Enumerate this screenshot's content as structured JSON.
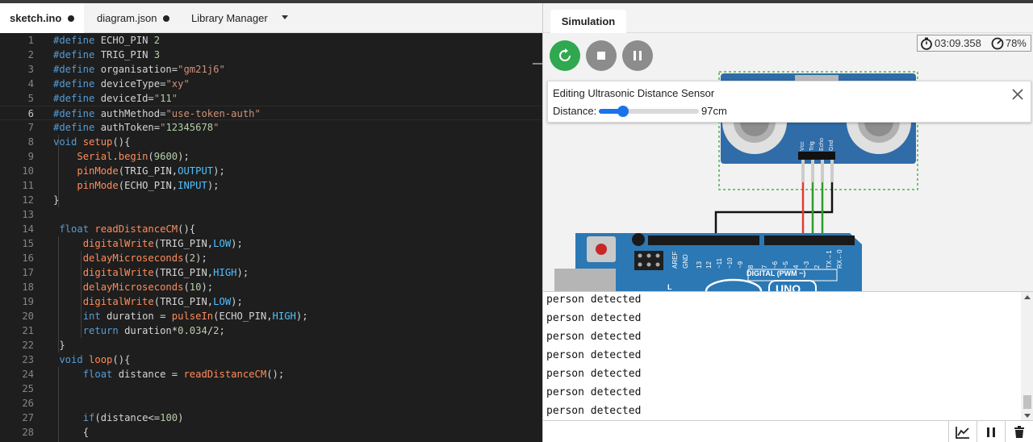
{
  "editor": {
    "tabs": [
      {
        "label": "sketch.ino",
        "modified": true
      },
      {
        "label": "diagram.json",
        "modified": true
      },
      {
        "label": "Library Manager",
        "dropdown": true
      }
    ],
    "lines": [
      {
        "num": "1",
        "text": "#define ECHO_PIN 2"
      },
      {
        "num": "2",
        "text": "#define TRIG_PIN 3"
      },
      {
        "num": "3",
        "text": "#define organisation=\"gm21j6\""
      },
      {
        "num": "4",
        "text": "#define deviceType=\"xy\""
      },
      {
        "num": "5",
        "text": "#define deviceId=\"11\""
      },
      {
        "num": "6",
        "text": "#define authMethod=\"use-token-auth\""
      },
      {
        "num": "7",
        "text": "#define authToken=\"12345678\""
      },
      {
        "num": "8",
        "text": "void setup(){"
      },
      {
        "num": "9",
        "text": "    Serial.begin(9600);"
      },
      {
        "num": "10",
        "text": "    pinMode(TRIG_PIN,OUTPUT);"
      },
      {
        "num": "11",
        "text": "    pinMode(ECHO_PIN,INPUT);"
      },
      {
        "num": "12",
        "text": "}"
      },
      {
        "num": "13",
        "text": ""
      },
      {
        "num": "14",
        "text": " float readDistanceCM(){"
      },
      {
        "num": "15",
        "text": "     digitalWrite(TRIG_PIN,LOW);"
      },
      {
        "num": "16",
        "text": "     delayMicroseconds(2);"
      },
      {
        "num": "17",
        "text": "     digitalWrite(TRIG_PIN,HIGH);"
      },
      {
        "num": "18",
        "text": "     delayMicroseconds(10);"
      },
      {
        "num": "19",
        "text": "     digitalWrite(TRIG_PIN,LOW);"
      },
      {
        "num": "20",
        "text": "     int duration = pulseIn(ECHO_PIN,HIGH);"
      },
      {
        "num": "21",
        "text": "     return duration*0.034/2;"
      },
      {
        "num": "22",
        "text": " }"
      },
      {
        "num": "23",
        "text": " void loop(){"
      },
      {
        "num": "24",
        "text": "     float distance = readDistanceCM();"
      },
      {
        "num": "25",
        "text": ""
      },
      {
        "num": "26",
        "text": ""
      },
      {
        "num": "27",
        "text": "     if(distance<=100)"
      },
      {
        "num": "28",
        "text": "     {"
      }
    ],
    "current_line": 6
  },
  "simulation": {
    "tab_label": "Simulation",
    "timer": "03:09.358",
    "speed": "78%",
    "controls": {
      "restart": "restart-icon",
      "stop": "stop-icon",
      "pause": "pause-icon"
    },
    "board": {
      "sensor_pins": [
        "Vcc",
        "Trig",
        "Echo",
        "Gnd"
      ],
      "header_labels": [
        "AREF",
        "GND",
        "13",
        "12",
        "~11",
        "~10",
        "~9",
        "8",
        "7",
        "~6",
        "~5",
        "4",
        "~3",
        "2",
        "TX→1",
        "RX←0"
      ],
      "digital_label": "DIGITAL (PWM ~)",
      "board_logo": "UNO",
      "l_label": "L"
    },
    "edit_panel": {
      "title": "Editing Ultrasonic Distance Sensor",
      "label": "Distance:",
      "value_text": "97cm",
      "slider_fraction": 0.24
    },
    "serial_monitor": {
      "lines": [
        "person detected",
        "person detected",
        "person detected",
        "person detected",
        "person detected",
        "person detected",
        "person detected"
      ],
      "input_value": "",
      "buttons": [
        "chart-icon",
        "pause-icon",
        "trash-icon"
      ]
    }
  }
}
